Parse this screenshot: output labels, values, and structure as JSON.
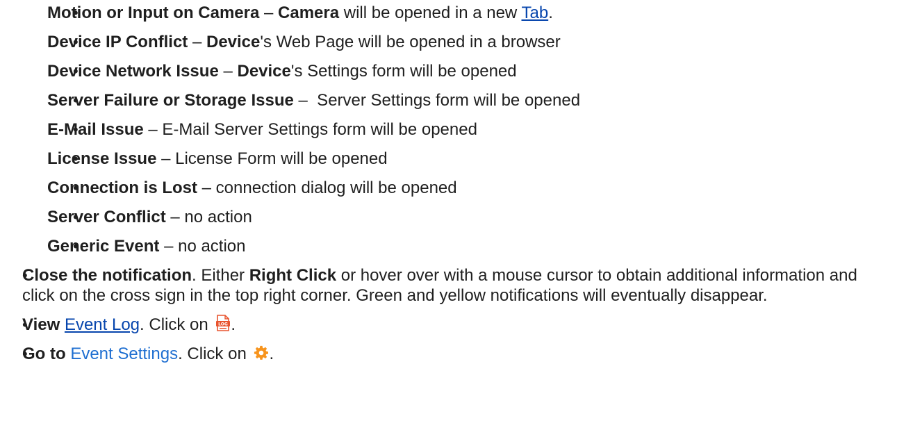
{
  "sub_items": [
    {
      "t1": "Motion or Input on Camera",
      "t2": " – ",
      "t3": "Camera",
      "t4": " will be opened in a new ",
      "link": "Tab",
      "t5": "."
    },
    {
      "t1": "Device IP Conflict",
      "t2": " – ",
      "t3": "Device",
      "t4": "'s Web Page will be opened in a browser"
    },
    {
      "t1": "Device Network Issue",
      "t2": " – ",
      "t3": "Device",
      "t4": "'s Settings form will be opened"
    },
    {
      "t1": "Server Failure or Storage Issue",
      "t2": " –  Server Settings form will be opened"
    },
    {
      "t1": "E-Mail Issue",
      "t2": " – E-Mail Server Settings form will be opened"
    },
    {
      "t1": "License Issue",
      "t2": " – License Form will be opened"
    },
    {
      "t1": "Connection is Lost",
      "t2": " – connection dialog will be opened"
    },
    {
      "t1": "Server Conflict",
      "t2": " – no action"
    },
    {
      "t1": "Generic Event",
      "t2": " – no action"
    }
  ],
  "close_item": {
    "b1": "Close the notification",
    "t1": ". Either ",
    "b2": "Right Click",
    "t2": " or hover over with a mouse cursor to obtain additional information and click on the cross sign in the top right corner. Green and yellow notifications will eventually disappear."
  },
  "view_item": {
    "b1": "View",
    "sp": " ",
    "link": "Event Log",
    "t1": ". Click on ",
    "icon": "log-file-icon",
    "t2": "."
  },
  "goto_item": {
    "b1": "Go to",
    "sp": " ",
    "link": "Event Settings",
    "t1": ". Click on ",
    "icon": "gear-icon",
    "t2": "."
  },
  "bullet": "•",
  "colors": {
    "link": "#0645ad",
    "link_alt": "#1f6fd1",
    "gear": "#f7941d",
    "log_icon": "#e8542e"
  }
}
